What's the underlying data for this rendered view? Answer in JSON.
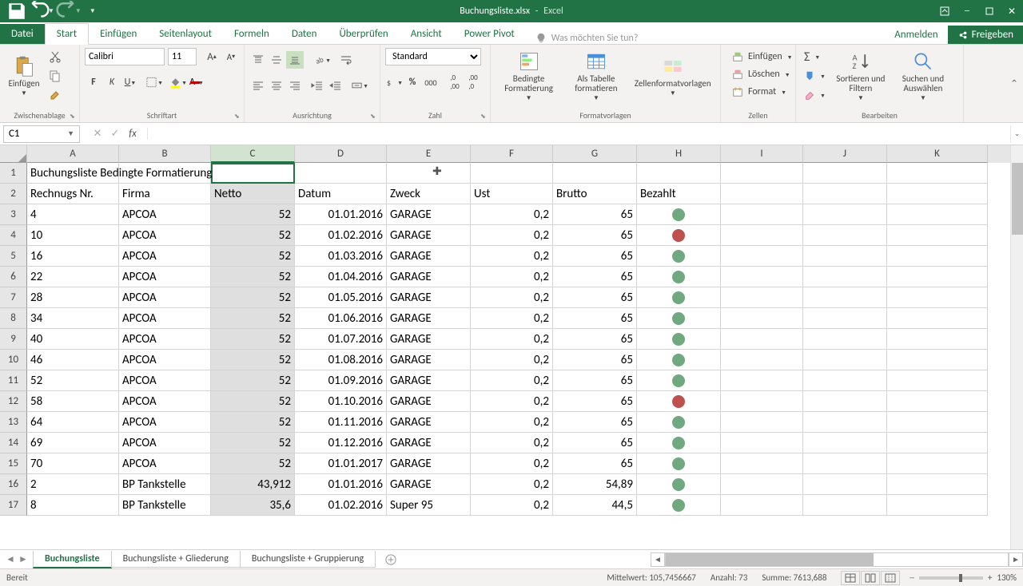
{
  "title": {
    "file": "Buchungsliste.xlsx",
    "app": "Excel"
  },
  "tabs": [
    "Datei",
    "Start",
    "Einfügen",
    "Seitenlayout",
    "Formeln",
    "Daten",
    "Überprüfen",
    "Ansicht",
    "Power Pivot"
  ],
  "tellme": "Was möchten Sie tun?",
  "signin": "Anmelden",
  "share": "Freigeben",
  "font": {
    "name": "Calibri",
    "size": "11"
  },
  "numfmt": "Standard",
  "groups": {
    "clipboard": "Zwischenablage",
    "paste": "Einfügen",
    "font": "Schriftart",
    "align": "Ausrichtung",
    "number": "Zahl",
    "styles": "Formatvorlagen",
    "cond": "Bedingte Formatierung",
    "table": "Als Tabelle formatieren",
    "cellst": "Zellenformatvorlagen",
    "cells": "Zellen",
    "insert": "Einfügen",
    "delete": "Löschen",
    "format": "Format",
    "edit": "Bearbeiten",
    "sortfilt": "Sortieren und Filtern",
    "findsel": "Suchen und Auswählen"
  },
  "namebox": "C1",
  "columns": [
    "A",
    "B",
    "C",
    "D",
    "E",
    "F",
    "G",
    "H",
    "I",
    "J",
    "K"
  ],
  "selectedCol": "C",
  "row1": "Buchungsliste Bedingte Formatierung",
  "headers": [
    "Rechnugs Nr.",
    "Firma",
    "Netto",
    "Datum",
    "Zweck",
    "Ust",
    "Brutto",
    "Bezahlt"
  ],
  "dataRows": [
    {
      "n": 3,
      "a": "4",
      "b": "APCOA",
      "c": "52",
      "d": "01.01.2016",
      "e": "GARAGE",
      "f": "0,2",
      "g": "65",
      "h": "green"
    },
    {
      "n": 4,
      "a": "10",
      "b": "APCOA",
      "c": "52",
      "d": "01.02.2016",
      "e": "GARAGE",
      "f": "0,2",
      "g": "65",
      "h": "red"
    },
    {
      "n": 5,
      "a": "16",
      "b": "APCOA",
      "c": "52",
      "d": "01.03.2016",
      "e": "GARAGE",
      "f": "0,2",
      "g": "65",
      "h": "green"
    },
    {
      "n": 6,
      "a": "22",
      "b": "APCOA",
      "c": "52",
      "d": "01.04.2016",
      "e": "GARAGE",
      "f": "0,2",
      "g": "65",
      "h": "green"
    },
    {
      "n": 7,
      "a": "28",
      "b": "APCOA",
      "c": "52",
      "d": "01.05.2016",
      "e": "GARAGE",
      "f": "0,2",
      "g": "65",
      "h": "green"
    },
    {
      "n": 8,
      "a": "34",
      "b": "APCOA",
      "c": "52",
      "d": "01.06.2016",
      "e": "GARAGE",
      "f": "0,2",
      "g": "65",
      "h": "green"
    },
    {
      "n": 9,
      "a": "40",
      "b": "APCOA",
      "c": "52",
      "d": "01.07.2016",
      "e": "GARAGE",
      "f": "0,2",
      "g": "65",
      "h": "green"
    },
    {
      "n": 10,
      "a": "46",
      "b": "APCOA",
      "c": "52",
      "d": "01.08.2016",
      "e": "GARAGE",
      "f": "0,2",
      "g": "65",
      "h": "green"
    },
    {
      "n": 11,
      "a": "52",
      "b": "APCOA",
      "c": "52",
      "d": "01.09.2016",
      "e": "GARAGE",
      "f": "0,2",
      "g": "65",
      "h": "green"
    },
    {
      "n": 12,
      "a": "58",
      "b": "APCOA",
      "c": "52",
      "d": "01.10.2016",
      "e": "GARAGE",
      "f": "0,2",
      "g": "65",
      "h": "red"
    },
    {
      "n": 13,
      "a": "64",
      "b": "APCOA",
      "c": "52",
      "d": "01.11.2016",
      "e": "GARAGE",
      "f": "0,2",
      "g": "65",
      "h": "green"
    },
    {
      "n": 14,
      "a": "69",
      "b": "APCOA",
      "c": "52",
      "d": "01.12.2016",
      "e": "GARAGE",
      "f": "0,2",
      "g": "65",
      "h": "green"
    },
    {
      "n": 15,
      "a": "70",
      "b": "APCOA",
      "c": "52",
      "d": "01.01.2017",
      "e": "GARAGE",
      "f": "0,2",
      "g": "65",
      "h": "green"
    },
    {
      "n": 16,
      "a": "2",
      "b": "BP Tankstelle",
      "c": "43,912",
      "d": "01.01.2016",
      "e": "GARAGE",
      "f": "0,2",
      "g": "54,89",
      "h": "green"
    },
    {
      "n": 17,
      "a": "8",
      "b": "BP Tankstelle",
      "c": "35,6",
      "d": "01.02.2016",
      "e": "Super 95",
      "f": "0,2",
      "g": "44,5",
      "h": "green"
    }
  ],
  "sheetTabs": [
    "Buchungsliste",
    "Buchungsliste + Gliederung",
    "Buchungsliste + Gruppierung"
  ],
  "status": {
    "ready": "Bereit",
    "avg": "Mittelwert: 105,7456667",
    "count": "Anzahl: 73",
    "sum": "Summe: 7613,688",
    "zoom": "130%"
  }
}
